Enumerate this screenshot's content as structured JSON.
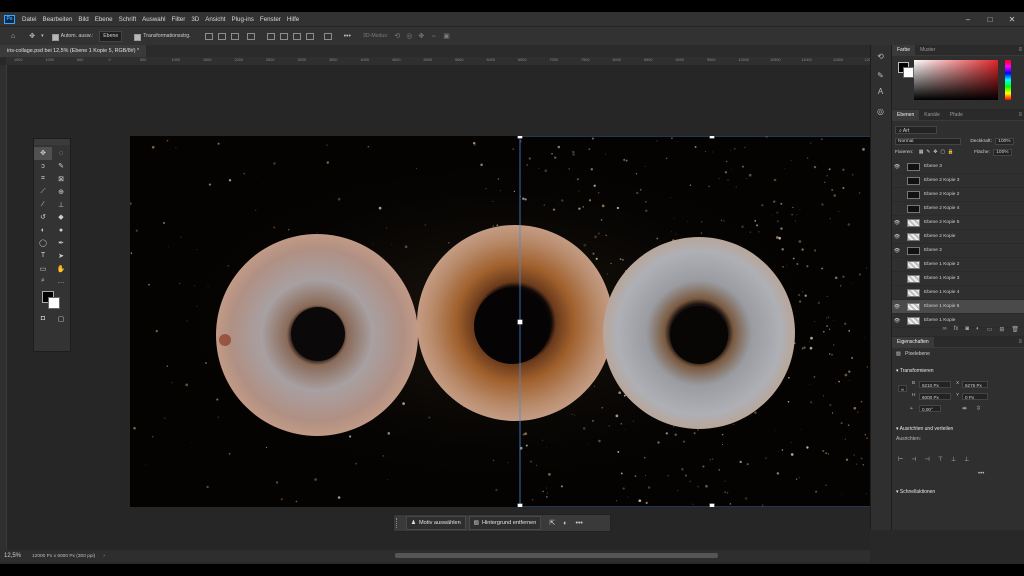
{
  "menubar": {
    "app_icon": "Ps",
    "items": [
      "Datei",
      "Bearbeiten",
      "Bild",
      "Ebene",
      "Schrift",
      "Auswahl",
      "Filter",
      "3D",
      "Ansicht",
      "Plug-ins",
      "Fenster",
      "Hilfe"
    ]
  },
  "window_controls": {
    "minimize": "–",
    "maximize": "□",
    "close": "✕"
  },
  "options_bar": {
    "auto_select_label": "Autom. ausw.:",
    "auto_select_target": "Ebene",
    "transform_label": "Transformationsstrg.",
    "mode_3d_label": "3D-Modus:"
  },
  "document": {
    "tab_title": "iris-collage.psd bei 12,5% (Ebene 1 Kopie 5, RGB/8#) *",
    "zoom": "12,5%",
    "info": "12000 Px x 6000 Px (300 ppi)"
  },
  "ruler_ticks": [
    "1500",
    "1000",
    "500",
    "0",
    "500",
    "1000",
    "1500",
    "2000",
    "2500",
    "3000",
    "3500",
    "4000",
    "4500",
    "5000",
    "5500",
    "6000",
    "6500",
    "7000",
    "7500",
    "8000",
    "8500",
    "9000",
    "9500",
    "10000",
    "10500",
    "11000",
    "11500",
    "12000",
    "12500",
    "13000"
  ],
  "context_bar": {
    "select_subject": "Motiv auswählen",
    "remove_background": "Hintergrund entfernen"
  },
  "color_panel": {
    "tabs": [
      "Farbe",
      "Muster"
    ]
  },
  "layers_panel": {
    "tabs": [
      "Ebenen",
      "Kanäle",
      "Pfade"
    ],
    "filter": "Art",
    "blend_mode": "Normal",
    "opacity_label": "Deckkraft:",
    "opacity_value": "100%",
    "lock_label": "Fixieren:",
    "fill_label": "Fläche:",
    "fill_value": "100%",
    "layers": [
      {
        "name": "Ebene 3",
        "visible": true,
        "thumb": "dark",
        "selected": false
      },
      {
        "name": "Ebene 2 Kopie 3",
        "visible": false,
        "thumb": "dark",
        "selected": false
      },
      {
        "name": "Ebene 2 Kopie 2",
        "visible": false,
        "thumb": "dark",
        "selected": false
      },
      {
        "name": "Ebene 2 Kopie 4",
        "visible": false,
        "thumb": "dark",
        "selected": false
      },
      {
        "name": "Ebene 2 Kopie 5",
        "visible": true,
        "thumb": "check",
        "selected": false
      },
      {
        "name": "Ebene 2 Kopie",
        "visible": true,
        "thumb": "check",
        "selected": false
      },
      {
        "name": "Ebene 2",
        "visible": true,
        "thumb": "dark",
        "selected": false
      },
      {
        "name": "Ebene 1 Kopie 2",
        "visible": false,
        "thumb": "check",
        "selected": false
      },
      {
        "name": "Ebene 1 Kopie 3",
        "visible": false,
        "thumb": "check",
        "selected": false
      },
      {
        "name": "Ebene 1 Kopie 4",
        "visible": false,
        "thumb": "check",
        "selected": false
      },
      {
        "name": "Ebene 1 Kopie 5",
        "visible": true,
        "thumb": "check",
        "selected": true
      },
      {
        "name": "Ebene 1 Kopie",
        "visible": true,
        "thumb": "check",
        "selected": false
      }
    ]
  },
  "properties_panel": {
    "title": "Eigenschaften",
    "layer_type": "Pixelebene",
    "transform_head": "Transformieren",
    "w_label": "B",
    "w_value": "6210 Px",
    "h_label": "H",
    "h_value": "6000 Px",
    "x_label": "X",
    "x_value": "6276 Px",
    "y_label": "Y",
    "y_value": "0 Px",
    "angle_value": "0,00°",
    "align_head": "Ausrichten und verteilen",
    "align_sub": "Ausrichten:",
    "quick_head": "Schnellaktionen"
  },
  "icons": {
    "home": "home-icon",
    "move": "move-icon",
    "more": "more-icon",
    "eye": "eye-icon"
  }
}
